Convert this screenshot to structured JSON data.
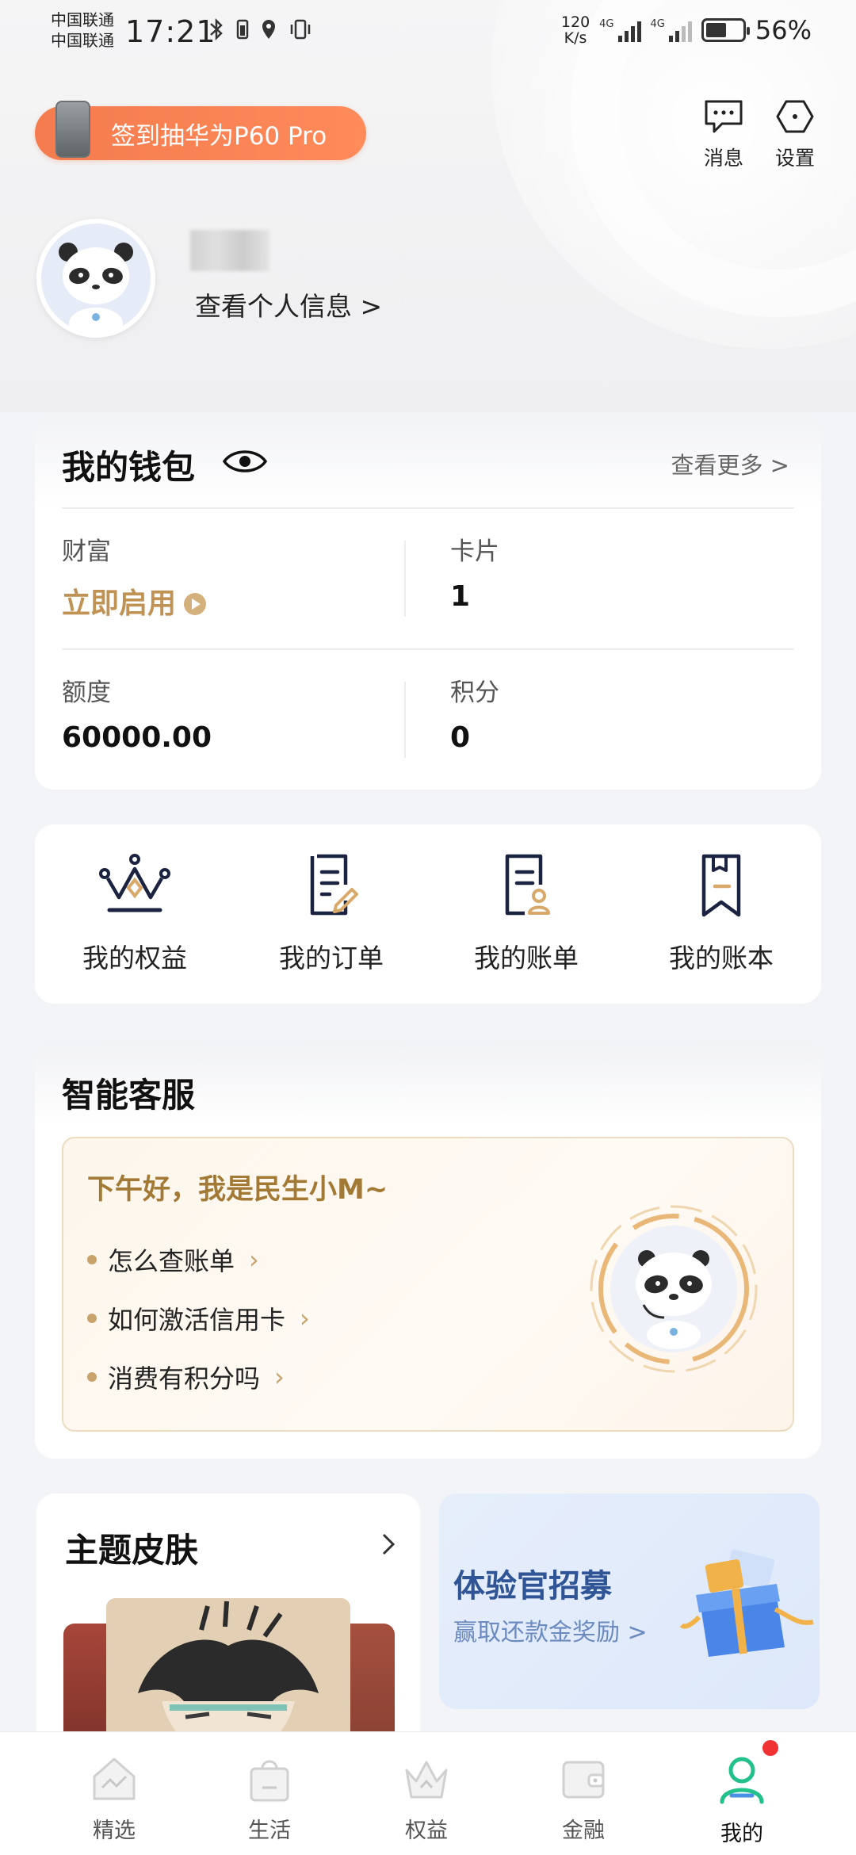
{
  "status_bar": {
    "carrier1": "中国联通",
    "carrier2": "中国联通",
    "time": "17:21",
    "net_speed_value": "120",
    "net_speed_unit": "K/s",
    "network1": "4G",
    "network2": "4G",
    "battery": "56%"
  },
  "header": {
    "promo_label": "签到抽华为P60 Pro",
    "messages_label": "消息",
    "settings_label": "设置"
  },
  "profile": {
    "link_label": "查看个人信息 >"
  },
  "wallet": {
    "title": "我的钱包",
    "more_label": "查看更多 >",
    "wealth_label": "财富",
    "wealth_value": "立即启用",
    "cards_label": "卡片",
    "cards_value": "1",
    "limit_label": "额度",
    "limit_value": "60000.00",
    "points_label": "积分",
    "points_value": "0"
  },
  "quick_actions": [
    {
      "label": "我的权益"
    },
    {
      "label": "我的订单"
    },
    {
      "label": "我的账单"
    },
    {
      "label": "我的账本"
    }
  ],
  "service": {
    "title": "智能客服",
    "greeting": "下午好，我是民生小M~",
    "faqs": [
      {
        "label": "怎么查账单"
      },
      {
        "label": "如何激活信用卡"
      },
      {
        "label": "消费有积分吗"
      }
    ]
  },
  "skin": {
    "title": "主题皮肤"
  },
  "recruit": {
    "title": "体验官招募",
    "subtitle": "赢取还款金奖励 >"
  },
  "bottom_nav": [
    {
      "label": "精选"
    },
    {
      "label": "生活"
    },
    {
      "label": "权益"
    },
    {
      "label": "金融"
    },
    {
      "label": "我的"
    }
  ],
  "colors": {
    "accent_gold": "#c09253",
    "promo_orange": "#f47c4e",
    "active_nav": "#22c08a",
    "badge_red": "#f03232"
  }
}
